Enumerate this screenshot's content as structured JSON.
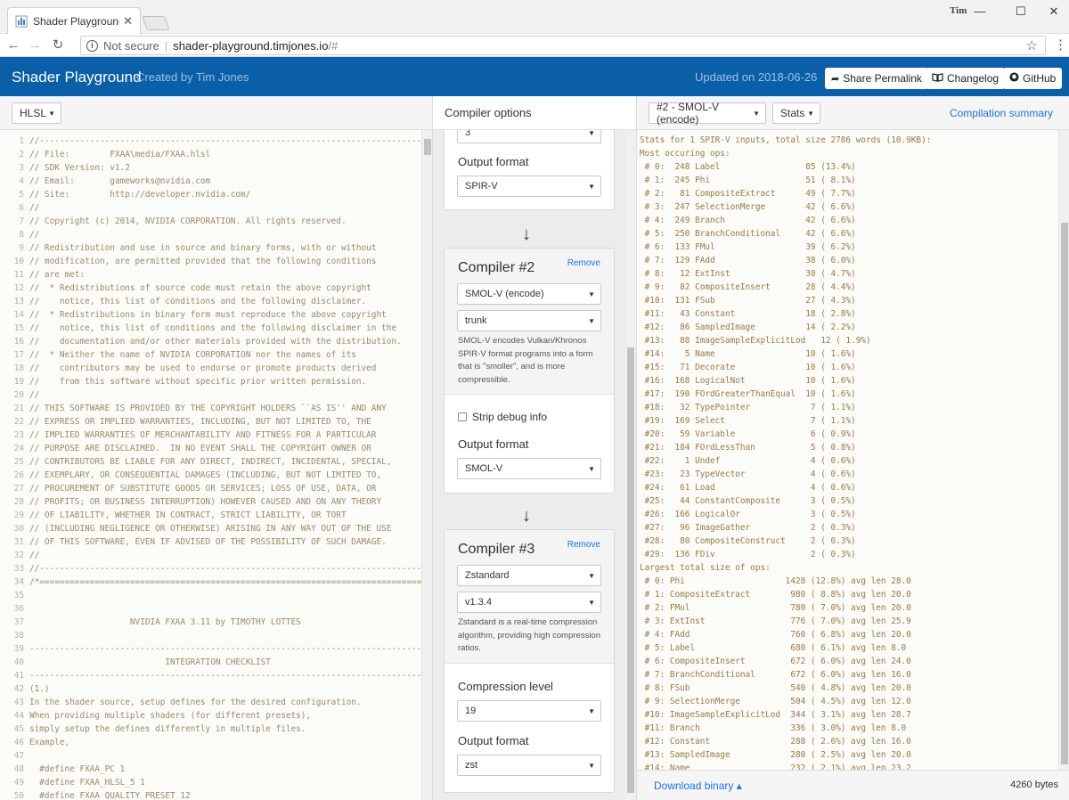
{
  "browser": {
    "tab_title": "Shader Playground",
    "tab_close": "✕",
    "user": "Tim",
    "win_min": "—",
    "win_max": "☐",
    "win_close": "✕",
    "nav_back": "←",
    "nav_forward": "→",
    "nav_reload": "↻",
    "info": "i",
    "secure_text": "Not secure",
    "sep": "|",
    "url_host": "shader-playground.timjones.io",
    "url_path": "/#",
    "star": "☆",
    "menu": "⋮"
  },
  "header": {
    "title": "Shader Playground",
    "subtitle": "Created by Tim Jones",
    "updated": "Updated on 2018-06-26",
    "share": "Share Permalink",
    "changelog": "Changelog",
    "github": "GitHub",
    "share_icon": "share-icon",
    "changelog_icon": "book-icon",
    "github_icon": "github-icon"
  },
  "toolbar": {
    "language": "HLSL",
    "compiler_options": "Compiler options",
    "output_select": "#2 - SMOL-V (encode)",
    "view_select": "Stats",
    "compilation_summary": "Compilation summary"
  },
  "editor": {
    "line_numbers": [
      "1",
      "2",
      "3",
      "4",
      "5",
      "6",
      "7",
      "8",
      "9",
      "10",
      "11",
      "12",
      "13",
      "14",
      "15",
      "16",
      "17",
      "18",
      "19",
      "20",
      "21",
      "22",
      "23",
      "24",
      "25",
      "26",
      "27",
      "28",
      "29",
      "30",
      "31",
      "32",
      "33",
      "34",
      "35",
      "36",
      "37",
      "38",
      "39",
      "40",
      "41",
      "42",
      "43",
      "44",
      "45",
      "46",
      "47",
      "48",
      "49",
      "50"
    ],
    "lines": [
      "//----------------------------------------------------------------------------------",
      "// File:        FXAA\\media/FXAA.hlsl",
      "// SDK Version: v1.2",
      "// Email:       gameworks@nvidia.com",
      "// Site:        http://developer.nvidia.com/",
      "//",
      "// Copyright (c) 2014, NVIDIA CORPORATION. All rights reserved.",
      "//",
      "// Redistribution and use in source and binary forms, with or without",
      "// modification, are permitted provided that the following conditions",
      "// are met:",
      "//  * Redistributions of source code must retain the above copyright",
      "//    notice, this list of conditions and the following disclaimer.",
      "//  * Redistributions in binary form must reproduce the above copyright",
      "//    notice, this list of conditions and the following disclaimer in the",
      "//    documentation and/or other materials provided with the distribution.",
      "//  * Neither the name of NVIDIA CORPORATION nor the names of its",
      "//    contributors may be used to endorse or promote products derived",
      "//    from this software without specific prior written permission.",
      "//",
      "// THIS SOFTWARE IS PROVIDED BY THE COPYRIGHT HOLDERS ``AS IS'' AND ANY",
      "// EXPRESS OR IMPLIED WARRANTIES, INCLUDING, BUT NOT LIMITED TO, THE",
      "// IMPLIED WARRANTIES OF MERCHANTABILITY AND FITNESS FOR A PARTICULAR",
      "// PURPOSE ARE DISCLAIMED.  IN NO EVENT SHALL THE COPYRIGHT OWNER OR",
      "// CONTRIBUTORS BE LIABLE FOR ANY DIRECT, INDIRECT, INCIDENTAL, SPECIAL,",
      "// EXEMPLARY, OR CONSEQUENTIAL DAMAGES (INCLUDING, BUT NOT LIMITED TO,",
      "// PROCUREMENT OF SUBSTITUTE GOODS OR SERVICES; LOSS OF USE, DATA, OR",
      "// PROFITS; OR BUSINESS INTERRUPTION) HOWEVER CAUSED AND ON ANY THEORY",
      "// OF LIABILITY, WHETHER IN CONTRACT, STRICT LIABILITY, OR TORT",
      "// (INCLUDING NEGLIGENCE OR OTHERWISE) ARISING IN ANY WAY OUT OF THE USE",
      "// OF THIS SOFTWARE, EVEN IF ADVISED OF THE POSSIBILITY OF SUCH DAMAGE.",
      "//",
      "//----------------------------------------------------------------------------------",
      "/*============================================================================",
      "",
      "",
      "                    NVIDIA FXAA 3.11 by TIMOTHY LOTTES",
      "",
      "------------------------------------------------------------------------------",
      "                           INTEGRATION CHECKLIST",
      "------------------------------------------------------------------------------",
      "(1.)",
      "In the shader source, setup defines for the desired configuration.",
      "When providing multiple shaders (for different presets),",
      "simply setup the defines differently in multiple files.",
      "Example,",
      "",
      "  #define FXAA_PC 1",
      "  #define FXAA_HLSL_5 1",
      "  #define FXAA_QUALITY_PRESET 12"
    ]
  },
  "pipeline": {
    "top_select": "3",
    "top_output_label": "Output format",
    "top_output": "SPIR-V",
    "arrow": "↓",
    "compiler2": {
      "title": "Compiler #2",
      "remove": "Remove",
      "compiler": "SMOL-V (encode)",
      "version": "trunk",
      "description": "SMOL-V encodes Vulkan/Khronos SPIR-V format programs into a form that is \"smoller\", and is more compressible.",
      "strip_label": "Strip debug info",
      "output_label": "Output format",
      "output": "SMOL-V"
    },
    "compiler3": {
      "title": "Compiler #3",
      "remove": "Remove",
      "compiler": "Zstandard",
      "version": "v1.3.4",
      "description": "Zstandard is a real-time compression algorithm, providing high compression ratios.",
      "level_label": "Compression level",
      "level": "19",
      "output_label": "Output format",
      "output": "zst"
    }
  },
  "stats": {
    "lines": [
      "Stats for 1 SPIR-V inputs, total size 2786 words (10.9KB):",
      "Most occuring ops:",
      " # 0:  248 Label                 85 (13.4%)",
      " # 1:  245 Phi                   51 ( 8.1%)",
      " # 2:   81 CompositeExtract      49 ( 7.7%)",
      " # 3:  247 SelectionMerge        42 ( 6.6%)",
      " # 4:  249 Branch                42 ( 6.6%)",
      " # 5:  250 BranchConditional     42 ( 6.6%)",
      " # 6:  133 FMul                  39 ( 6.2%)",
      " # 7:  129 FAdd                  38 ( 6.0%)",
      " # 8:   12 ExtInst               30 ( 4.7%)",
      " # 9:   82 CompositeInsert       28 ( 4.4%)",
      " #10:  131 FSub                  27 ( 4.3%)",
      " #11:   43 Constant              18 ( 2.8%)",
      " #12:   86 SampledImage          14 ( 2.2%)",
      " #13:   88 ImageSampleExplicitLod   12 ( 1.9%)",
      " #14:    5 Name                  10 ( 1.6%)",
      " #15:   71 Decorate              10 ( 1.6%)",
      " #16:  168 LogicalNot            10 ( 1.6%)",
      " #17:  190 FOrdGreaterThanEqual  10 ( 1.6%)",
      " #18:   32 TypePointer            7 ( 1.1%)",
      " #19:  169 Select                 7 ( 1.1%)",
      " #20:   59 Variable               6 ( 0.9%)",
      " #21:  184 FOrdLessThan           5 ( 0.8%)",
      " #22:    1 Undef                  4 ( 0.6%)",
      " #23:   23 TypeVector             4 ( 0.6%)",
      " #24:   61 Load                   4 ( 0.6%)",
      " #25:   44 ConstantComposite      3 ( 0.5%)",
      " #26:  166 LogicalOr              3 ( 0.5%)",
      " #27:   96 ImageGather            2 ( 0.3%)",
      " #28:   80 CompositeConstruct     2 ( 0.3%)",
      " #29:  136 FDiv                   2 ( 0.3%)",
      "Largest total size of ops:",
      " # 0: Phi                    1428 (12.8%) avg len 28.0",
      " # 1: CompositeExtract        980 ( 8.8%) avg len 20.0",
      " # 2: FMul                    780 ( 7.0%) avg len 20.0",
      " # 3: ExtInst                 776 ( 7.0%) avg len 25.9",
      " # 4: FAdd                    760 ( 6.8%) avg len 20.0",
      " # 5: Label                   680 ( 6.1%) avg len 8.0",
      " # 6: CompositeInsert         672 ( 6.0%) avg len 24.0",
      " # 7: BranchConditional       672 ( 6.0%) avg len 16.0",
      " # 8: FSub                    540 ( 4.8%) avg len 20.0",
      " # 9: SelectionMerge          504 ( 4.5%) avg len 12.0",
      " #10: ImageSampleExplicitLod  344 ( 3.1%) avg len 28.7",
      " #11: Branch                  336 ( 3.0%) avg len 8.0",
      " #12: Constant                288 ( 2.6%) avg len 16.0",
      " #13: SampledImage            280 ( 2.5%) avg len 20.0",
      " #14: Name                    232 ( 2.1%) avg len 23.2"
    ]
  },
  "footer": {
    "download": "Download binary ▴",
    "size": "4260 bytes"
  },
  "colors": {
    "header_bg": "#0b5ea8",
    "code_text": "#9a8a6a",
    "stats_text": "#9a7a4a",
    "link": "#1a73e8"
  }
}
